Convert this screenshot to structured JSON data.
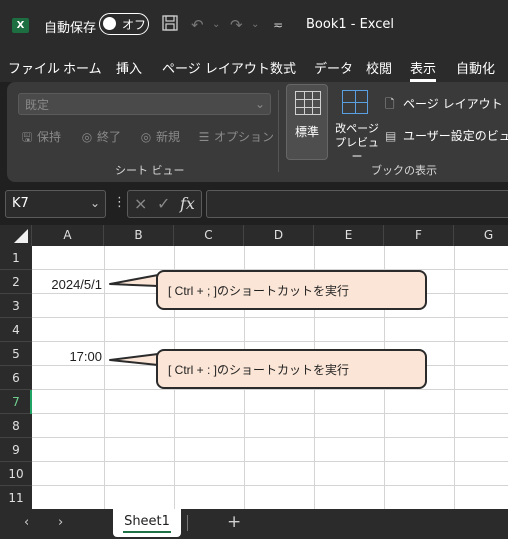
{
  "titlebar": {
    "app_logo": "X",
    "autosave_label": "自動保存",
    "autosave_toggle": "オフ",
    "save_icon": "save-icon",
    "undo_icon": "undo-icon",
    "redo_icon": "redo-icon",
    "customize_icon": "quick-access-customize-icon",
    "doc_title": "Book1  -  Excel"
  },
  "tabs": [
    "ファイル",
    "ホーム",
    "挿入",
    "ページ レイアウト",
    "数式",
    "データ",
    "校閲",
    "表示",
    "自動化"
  ],
  "active_tab": "表示",
  "ribbon": {
    "sheetview": {
      "select_value": "既定",
      "keep": "保持",
      "exit": "終了",
      "new": "新規",
      "options": "オプション",
      "group_label": "シート ビュー"
    },
    "workbook_views": {
      "normal": "標準",
      "page_break_preview_line1": "改ページ",
      "page_break_preview_line2": "プレビュー",
      "page_layout": "ページ レイアウト",
      "custom_views": "ユーザー設定のビュー",
      "group_label": "ブックの表示"
    }
  },
  "formula_bar": {
    "name_box": "K7",
    "cancel_icon": "×",
    "enter_icon": "✓",
    "fx_label": "fx",
    "formula_value": ""
  },
  "columns": [
    "A",
    "B",
    "C",
    "D",
    "E",
    "F",
    "G"
  ],
  "rows": [
    "1",
    "2",
    "3",
    "4",
    "5",
    "6",
    "7",
    "8",
    "9",
    "10",
    "11"
  ],
  "selected_row": "7",
  "cells": {
    "A2": "2024/5/1",
    "A5": "17:00"
  },
  "callouts": {
    "c1": "[ Ctrl + ; ]のショートカットを実行",
    "c2": "[ Ctrl + : ]のショートカットを実行"
  },
  "sheetbar": {
    "prev": "‹",
    "next": "›",
    "sheet_name": "Sheet1",
    "add": "+"
  }
}
